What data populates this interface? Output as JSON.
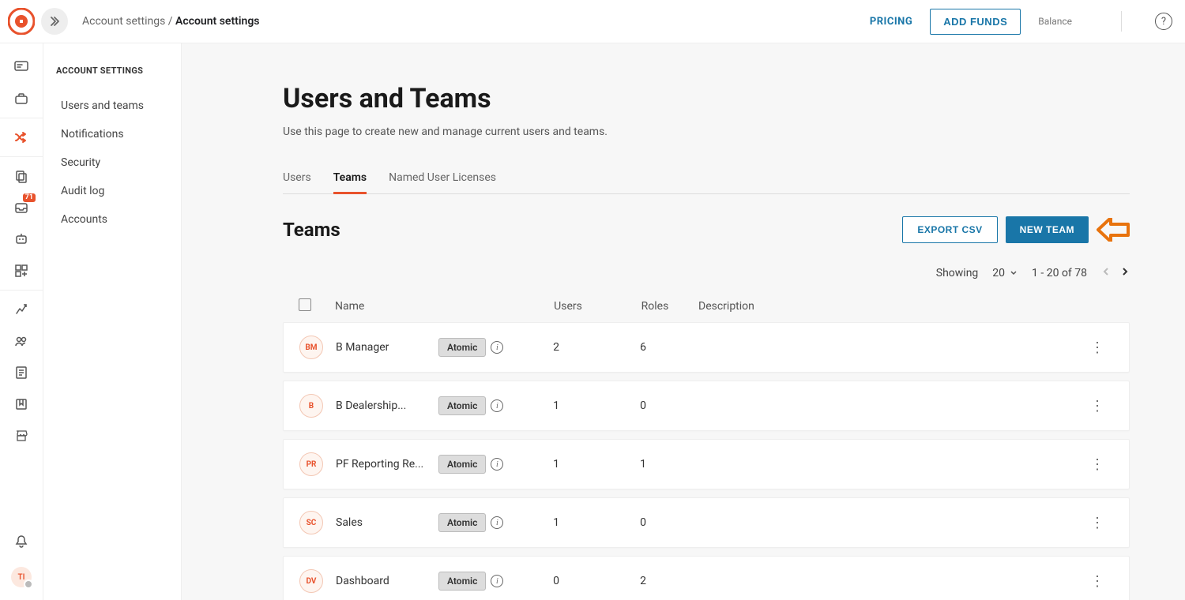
{
  "header": {
    "breadcrumb_parent": "Account settings",
    "breadcrumb_current": "Account settings",
    "pricing": "PRICING",
    "add_funds": "ADD FUNDS",
    "balance_label": "Balance"
  },
  "rail": {
    "badge_count": "71",
    "avatar_initials": "TI"
  },
  "sidebar": {
    "title": "ACCOUNT SETTINGS",
    "items": [
      "Users and teams",
      "Notifications",
      "Security",
      "Audit log",
      "Accounts"
    ]
  },
  "main": {
    "title": "Users and Teams",
    "subtitle": "Use this page to create new and manage current users and teams.",
    "tabs": [
      "Users",
      "Teams",
      "Named User Licenses"
    ],
    "active_tab": 1,
    "section_title": "Teams",
    "export_btn": "EXPORT CSV",
    "new_team_btn": "NEW TEAM",
    "pager": {
      "showing": "Showing",
      "page_size": "20",
      "range": "1 - 20 of 78"
    },
    "columns": {
      "name": "Name",
      "users": "Users",
      "roles": "Roles",
      "desc": "Description"
    },
    "rows": [
      {
        "initials": "BM",
        "name": "B  Manager",
        "badge": "Atomic",
        "users": "2",
        "roles": "6"
      },
      {
        "initials": "B",
        "name": "B Dealership...",
        "badge": "Atomic",
        "users": "1",
        "roles": "0"
      },
      {
        "initials": "PR",
        "name": "PF Reporting Re...",
        "badge": "Atomic",
        "users": "1",
        "roles": "1"
      },
      {
        "initials": "SC",
        "name": "Sales",
        "badge": "Atomic",
        "users": "1",
        "roles": "0"
      },
      {
        "initials": "DV",
        "name": "Dashboard",
        "badge": "Atomic",
        "users": "0",
        "roles": "2"
      }
    ]
  }
}
